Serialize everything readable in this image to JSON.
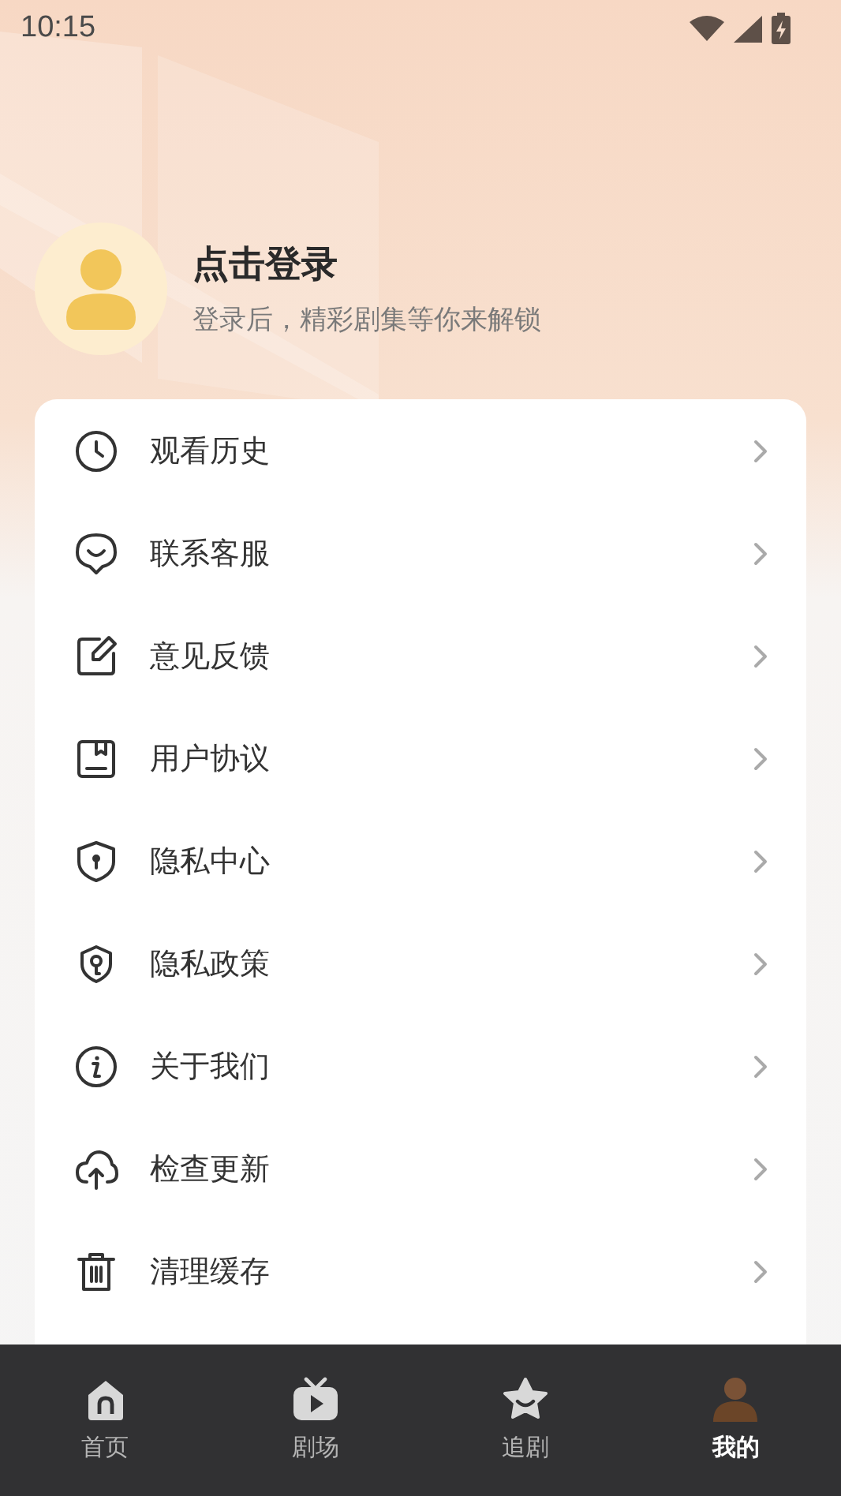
{
  "status_bar": {
    "time": "10:15"
  },
  "profile": {
    "title": "点击登录",
    "subtitle": "登录后，精彩剧集等你来解锁"
  },
  "menu": [
    {
      "label": "观看历史"
    },
    {
      "label": "联系客服"
    },
    {
      "label": "意见反馈"
    },
    {
      "label": "用户协议"
    },
    {
      "label": "隐私中心"
    },
    {
      "label": "隐私政策"
    },
    {
      "label": "关于我们"
    },
    {
      "label": "检查更新"
    },
    {
      "label": "清理缓存"
    }
  ],
  "tabs": [
    {
      "label": "首页",
      "selected": false
    },
    {
      "label": "剧场",
      "selected": false
    },
    {
      "label": "追剧",
      "selected": false
    },
    {
      "label": "我的",
      "selected": true
    }
  ]
}
